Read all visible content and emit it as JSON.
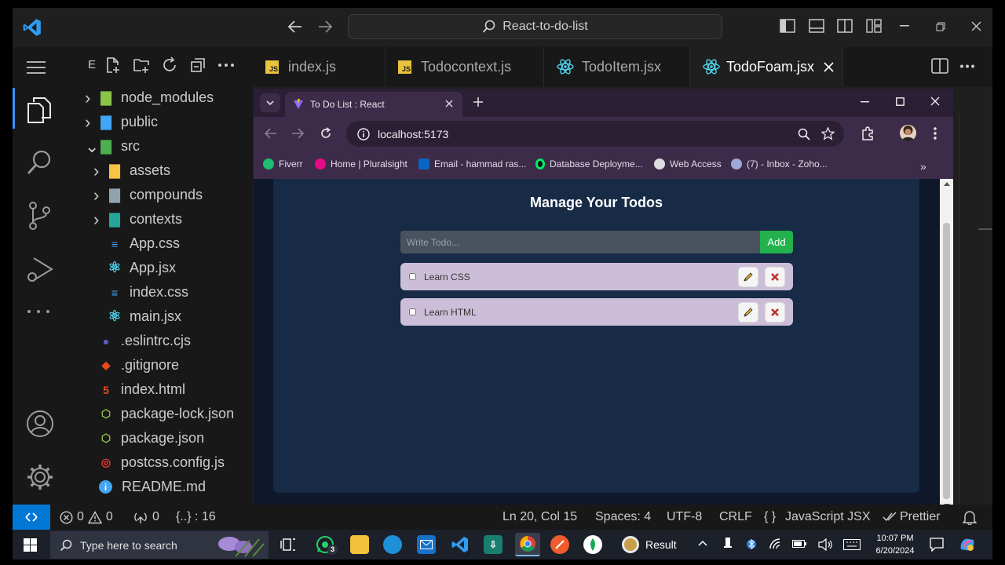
{
  "window": {
    "search_text": "React-to-do-list",
    "explorer_abbrev": "E"
  },
  "explorer": {
    "items": [
      {
        "label": "node_modules",
        "icon": "folder-node-icon",
        "kind": "folder",
        "expanded": false
      },
      {
        "label": "public",
        "icon": "folder-public-icon",
        "kind": "folder",
        "expanded": false
      },
      {
        "label": "src",
        "icon": "folder-src-icon",
        "kind": "folder",
        "expanded": true
      },
      {
        "label": "assets",
        "icon": "folder-assets-icon",
        "kind": "folder",
        "expanded": false
      },
      {
        "label": "compounds",
        "icon": "folder-icon",
        "kind": "folder",
        "expanded": false
      },
      {
        "label": "contexts",
        "icon": "folder-contexts-icon",
        "kind": "folder",
        "expanded": false
      },
      {
        "label": "App.css",
        "icon": "css-file-icon",
        "kind": "file"
      },
      {
        "label": "App.jsx",
        "icon": "react-file-icon",
        "kind": "file"
      },
      {
        "label": "index.css",
        "icon": "css-file-icon",
        "kind": "file"
      },
      {
        "label": "main.jsx",
        "icon": "react-file-icon",
        "kind": "file"
      },
      {
        "label": ".eslintrc.cjs",
        "icon": "eslint-file-icon",
        "kind": "file"
      },
      {
        "label": ".gitignore",
        "icon": "git-file-icon",
        "kind": "file"
      },
      {
        "label": "index.html",
        "icon": "html-file-icon",
        "kind": "file"
      },
      {
        "label": "package-lock.json",
        "icon": "nodejs-file-icon",
        "kind": "file"
      },
      {
        "label": "package.json",
        "icon": "nodejs-file-icon",
        "kind": "file"
      },
      {
        "label": "postcss.config.js",
        "icon": "postcss-file-icon",
        "kind": "file"
      },
      {
        "label": "README.md",
        "icon": "info-file-icon",
        "kind": "file"
      }
    ]
  },
  "tabs": [
    {
      "label": "index.js",
      "icon": "js-file-icon",
      "badge": "JS"
    },
    {
      "label": "Todocontext.js",
      "icon": "js-file-icon",
      "badge": "JS"
    },
    {
      "label": "TodoItem.jsx",
      "icon": "react-file-icon"
    },
    {
      "label": "TodoFoam.jsx",
      "icon": "react-file-icon",
      "active": true
    }
  ],
  "browser": {
    "tab_title": "To Do List : React",
    "url": "localhost:5173",
    "bookmarks": [
      {
        "label": "Fiverr",
        "color": "#1dbf73"
      },
      {
        "label": "Home | Pluralsight",
        "color": "#e80a89"
      },
      {
        "label": "Email - hammad ras...",
        "color": "#0a66c2"
      },
      {
        "label": "Database Deployme...",
        "color": "#00ed64"
      },
      {
        "label": "Web Access",
        "color": "#dddddd"
      },
      {
        "label": "(7) - Inbox - Zoho...",
        "color": "#9fa8da"
      }
    ]
  },
  "app": {
    "title": "Manage Your Todos",
    "input_placeholder": "Write Todo...",
    "add_label": "Add",
    "todos": [
      {
        "text": "Learn CSS",
        "done": false
      },
      {
        "text": "Learn HTML",
        "done": false
      }
    ]
  },
  "statusbar": {
    "errors": "0",
    "warnings": "0",
    "ports": "0",
    "braces": "{..} : 16",
    "position": "Ln 20, Col 15",
    "spaces": "Spaces: 4",
    "encoding": "UTF-8",
    "eol": "CRLF",
    "language": "JavaScript JSX",
    "formatter": "Prettier"
  },
  "taskbar": {
    "search_placeholder": "Type here to search",
    "whatsapp_badge": "3",
    "result_label": "Result",
    "time": "10:07 PM",
    "date": "6/20/2024"
  },
  "colors": {
    "accent": "#0078d4",
    "add_button": "#22b14c",
    "todo_bg": "#ccbed8",
    "page_bg": "#172a46"
  }
}
